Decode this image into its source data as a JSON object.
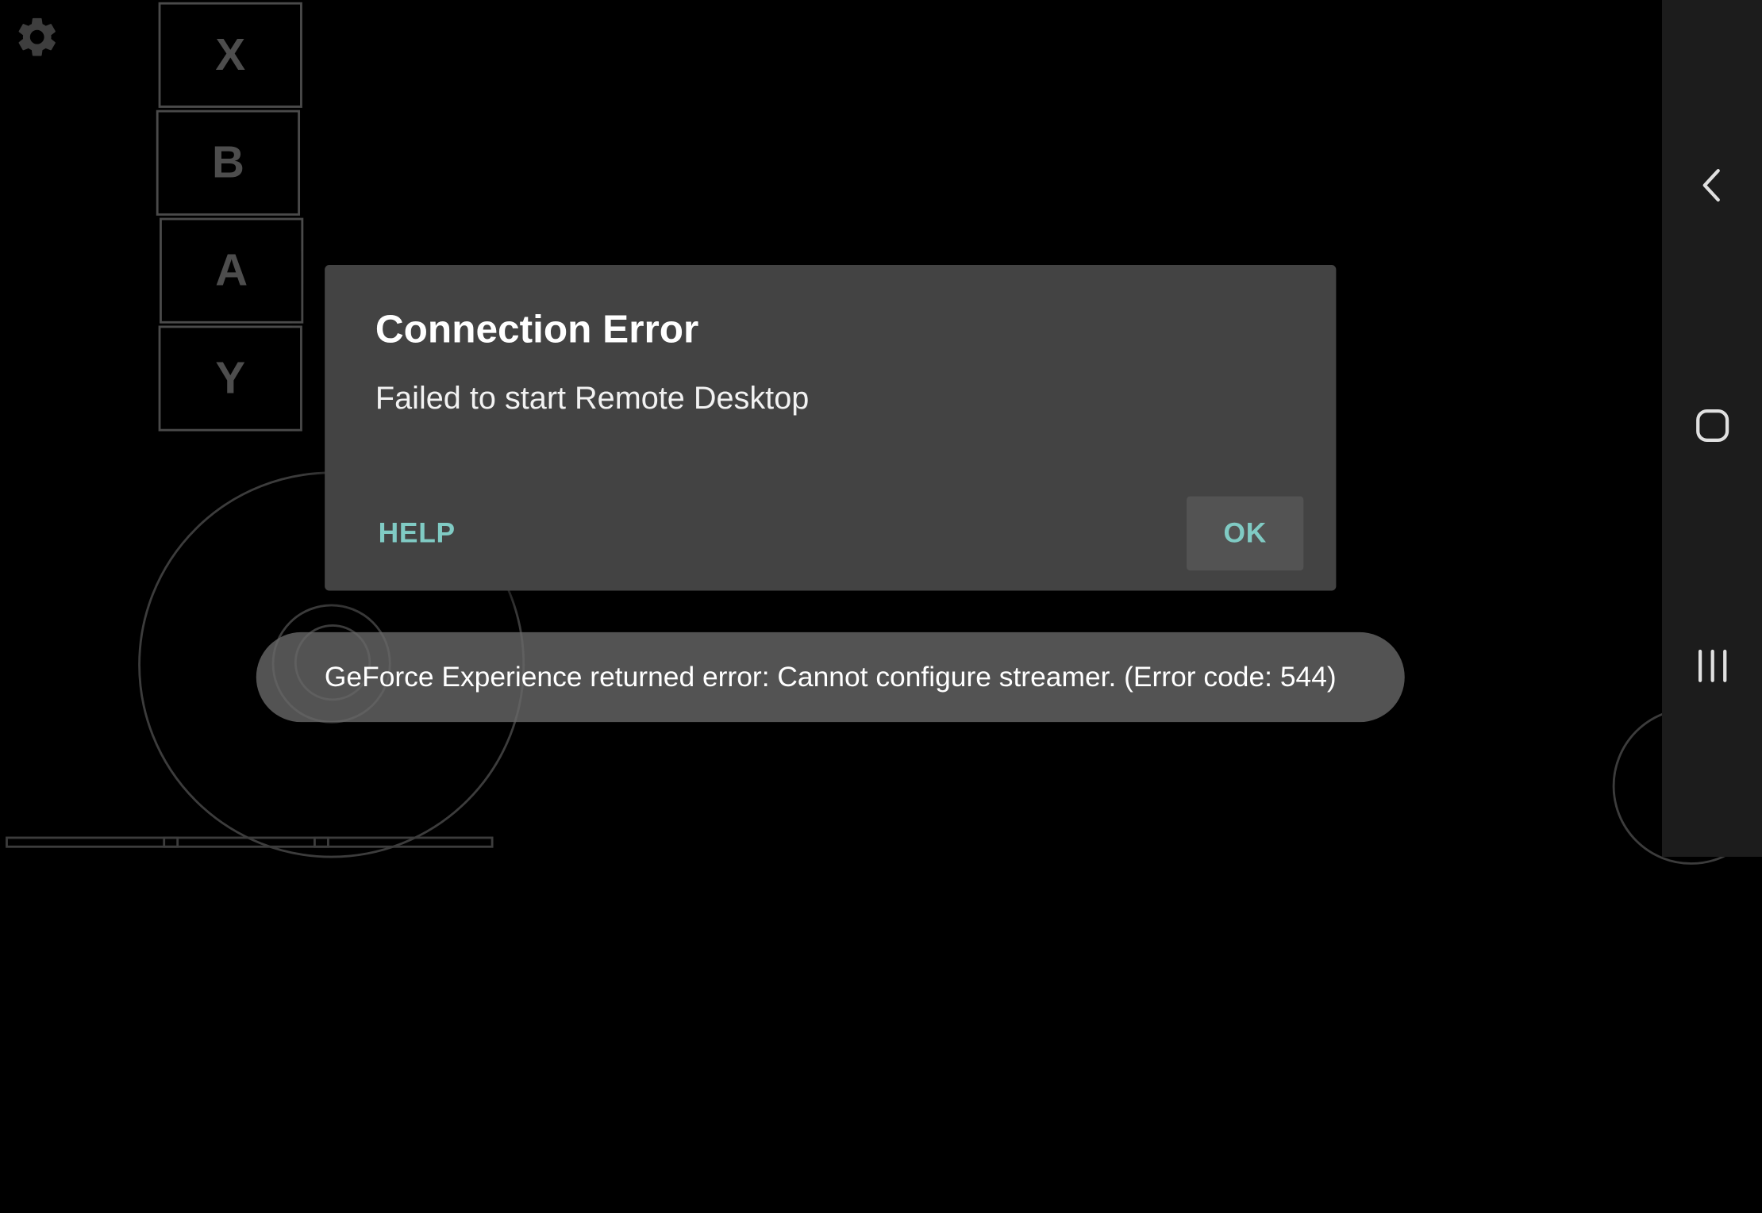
{
  "overlay": {
    "settings_icon": "gear-icon",
    "face_buttons": {
      "x": "X",
      "b": "B",
      "a": "A",
      "y": "Y"
    }
  },
  "dialog": {
    "title": "Connection Error",
    "message": "Failed to start Remote Desktop",
    "help_label": "HELP",
    "ok_label": "OK",
    "accent_color": "#80cbc4"
  },
  "toast": {
    "text": "GeForce Experience returned error: Cannot configure streamer. (Error code: 544)"
  },
  "navbar": {
    "back_icon": "back-icon",
    "home_icon": "home-icon",
    "recents_icon": "recents-icon"
  }
}
